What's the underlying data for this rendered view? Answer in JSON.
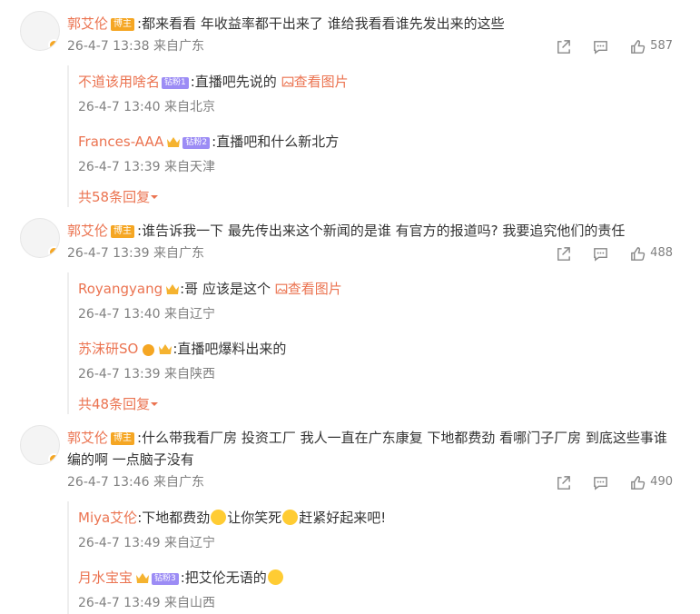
{
  "comments": [
    {
      "author": "郭艾伦",
      "badge": "博主",
      "text": ":都来看看 年收益率都干出来了 谁给我看看谁先发出来的这些",
      "time": "26-4-7 13:38 来自广东",
      "likes": "587",
      "replies": [
        {
          "author": "不道该用啥名",
          "tag": "钻粉1",
          "text": ":直播吧先说的",
          "link": "查看图片",
          "time": "26-4-7 13:40 来自北京"
        },
        {
          "author": "Frances-AAA",
          "tag": "钻粉2",
          "text": ":直播吧和什么新北方",
          "time": "26-4-7 13:39 来自天津"
        }
      ],
      "more": "共58条回复"
    },
    {
      "author": "郭艾伦",
      "badge": "博主",
      "text": ":谁告诉我一下 最先传出来这个新闻的是谁 有官方的报道吗? 我要追究他们的责任",
      "time": "26-4-7 13:39 来自广东",
      "likes": "488",
      "replies": [
        {
          "author": "Royangyang",
          "text": ":哥 应该是这个",
          "link": "查看图片",
          "time": "26-4-7 13:40 来自辽宁"
        },
        {
          "author": "苏沫研SO",
          "text": ":直播吧爆料出来的",
          "time": "26-4-7 13:39 来自陕西"
        }
      ],
      "more": "共48条回复"
    },
    {
      "author": "郭艾伦",
      "badge": "博主",
      "text": ":什么带我看厂房 投资工厂 我人一直在广东康复 下地都费劲 看哪门子厂房 到底这些事谁编的啊 一点脑子没有",
      "time": "26-4-7 13:46 来自广东",
      "likes": "490",
      "replies": [
        {
          "author": "Miya艾伦",
          "text1": ":下地都费劲",
          "text2": "让你笑死",
          "text3": "赶紧好起来吧!",
          "time": "26-4-7 13:49 来自辽宁"
        },
        {
          "author": "月水宝宝",
          "tag": "钻粉3",
          "text": ":把艾伦无语的",
          "time": "26-4-7 13:49 来自山西"
        }
      ]
    }
  ],
  "icons": {
    "share": "share-icon",
    "comment": "comment-icon",
    "like": "like-icon",
    "chevron": "chevron-down-icon",
    "image": "image-icon",
    "crown": "crown-icon"
  },
  "colors": {
    "accent": "#eb7350",
    "meta": "#808080",
    "text": "#333333",
    "vip": "#f5a623"
  }
}
